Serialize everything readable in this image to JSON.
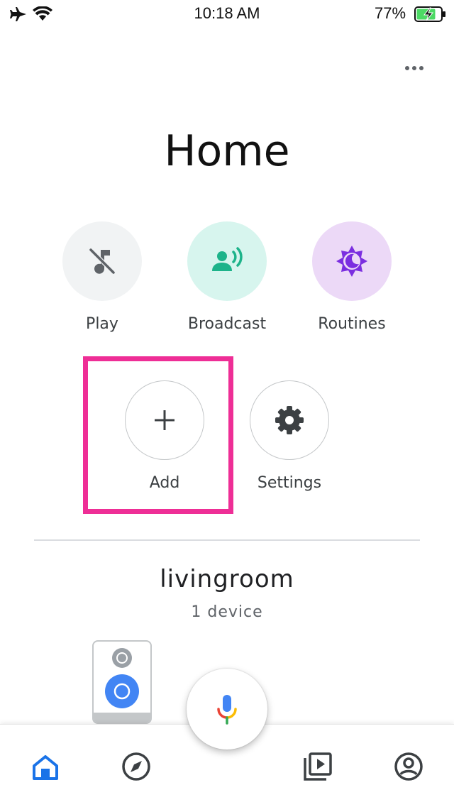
{
  "status_bar": {
    "time": "10:18 AM",
    "battery_percent": "77%",
    "battery_level": 0.77,
    "icons": [
      "airplane-icon",
      "wifi-icon",
      "battery-charging-icon"
    ]
  },
  "header": {
    "title": "Home",
    "more_icon": "more-horizontal-icon"
  },
  "actions": [
    {
      "label": "Play",
      "icon": "music-off-icon",
      "bg": "#f1f3f4",
      "fg": "#5f6368"
    },
    {
      "label": "Broadcast",
      "icon": "broadcast-icon",
      "bg": "#d7f5ee",
      "fg": "#1db38a"
    },
    {
      "label": "Routines",
      "icon": "routines-icon",
      "bg": "#ecd9f7",
      "fg": "#7b2ee0"
    },
    {
      "label": "Add",
      "icon": "plus-icon",
      "bg": "#ffffff",
      "fg": "#3c4043"
    },
    {
      "label": "Settings",
      "icon": "gear-icon",
      "bg": "#ffffff",
      "fg": "#3c4043"
    }
  ],
  "highlight_color": "#ee2e96",
  "room": {
    "name": "livingroom",
    "device_count": "1 device",
    "device_icon": "speaker-icon"
  },
  "bottom_nav": {
    "items": [
      "home-icon",
      "explore-icon",
      "media-icon",
      "account-icon"
    ],
    "active": "home-icon",
    "active_color": "#1a73e8",
    "mic_icon": "mic-icon"
  }
}
